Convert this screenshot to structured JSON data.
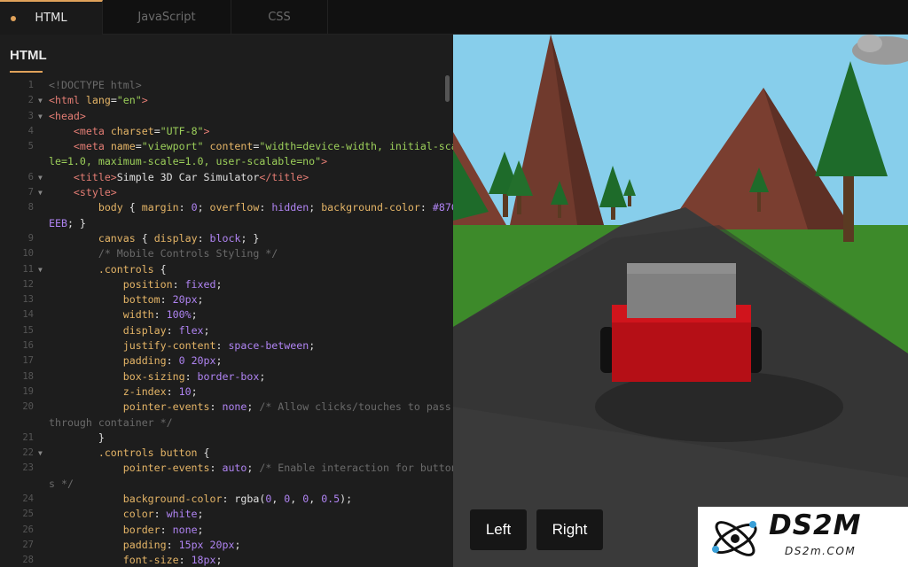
{
  "tabs": [
    {
      "label": "HTML",
      "active": true
    },
    {
      "label": "JavaScript",
      "active": false
    },
    {
      "label": "CSS",
      "active": false
    }
  ],
  "editor": {
    "title": "HTML",
    "lines": [
      {
        "n": "1",
        "fold": false,
        "html": "<span class='cm'>&lt;!DOCTYPE html&gt;</span>"
      },
      {
        "n": "2",
        "fold": true,
        "html": "<span class='tg'>&lt;html</span> <span class='at'>lang</span>=<span class='st'>\"en\"</span><span class='tg'>&gt;</span>"
      },
      {
        "n": "3",
        "fold": true,
        "html": "<span class='tg'>&lt;head&gt;</span>"
      },
      {
        "n": "4",
        "fold": false,
        "html": "    <span class='tg'>&lt;meta</span> <span class='at'>charset</span>=<span class='st'>\"UTF-8\"</span><span class='tg'>&gt;</span>"
      },
      {
        "n": "5",
        "fold": false,
        "html": "    <span class='tg'>&lt;meta</span> <span class='at'>name</span>=<span class='st'>\"viewport\"</span> <span class='at'>content</span>=<span class='st'>\"width=device-width, initial-sca</span>"
      },
      {
        "n": "",
        "fold": false,
        "html": "<span class='st'>le=1.0, maximum-scale=1.0, user-scalable=no\"</span><span class='tg'>&gt;</span>"
      },
      {
        "n": "6",
        "fold": true,
        "html": "    <span class='tg'>&lt;title&gt;</span>Simple 3D Car Simulator<span class='tg'>&lt;/title&gt;</span>"
      },
      {
        "n": "7",
        "fold": true,
        "html": "    <span class='tg'>&lt;style&gt;</span>"
      },
      {
        "n": "8",
        "fold": false,
        "html": "        <span class='sel'>body</span> { <span class='at'>margin</span>: <span class='kw'>0</span>; <span class='at'>overflow</span>: <span class='kw'>hidden</span>; <span class='at'>background-color</span>: <span class='kw'>#87C</span>"
      },
      {
        "n": "",
        "fold": false,
        "html": "<span class='kw'>EEB</span>; }"
      },
      {
        "n": "9",
        "fold": false,
        "html": "        <span class='sel'>canvas</span> { <span class='at'>display</span>: <span class='kw'>block</span>; }"
      },
      {
        "n": "10",
        "fold": false,
        "html": "        <span class='cm'>/* Mobile Controls Styling */</span>"
      },
      {
        "n": "11",
        "fold": true,
        "html": "        <span class='sel'>.controls</span> {"
      },
      {
        "n": "12",
        "fold": false,
        "html": "            <span class='at'>position</span>: <span class='kw'>fixed</span>;"
      },
      {
        "n": "13",
        "fold": false,
        "html": "            <span class='at'>bottom</span>: <span class='kw'>20px</span>;"
      },
      {
        "n": "14",
        "fold": false,
        "html": "            <span class='at'>width</span>: <span class='kw'>100%</span>;"
      },
      {
        "n": "15",
        "fold": false,
        "html": "            <span class='at'>display</span>: <span class='kw'>flex</span>;"
      },
      {
        "n": "16",
        "fold": false,
        "html": "            <span class='at'>justify-content</span>: <span class='kw'>space-between</span>;"
      },
      {
        "n": "17",
        "fold": false,
        "html": "            <span class='at'>padding</span>: <span class='kw'>0 20px</span>;"
      },
      {
        "n": "18",
        "fold": false,
        "html": "            <span class='at'>box-sizing</span>: <span class='kw'>border-box</span>;"
      },
      {
        "n": "19",
        "fold": false,
        "html": "            <span class='at'>z-index</span>: <span class='kw'>10</span>;"
      },
      {
        "n": "20",
        "fold": false,
        "html": "            <span class='at'>pointer-events</span>: <span class='kw'>none</span>; <span class='cm'>/* Allow clicks/touches to pass</span>"
      },
      {
        "n": "",
        "fold": false,
        "html": "<span class='cm'>through container */</span>"
      },
      {
        "n": "21",
        "fold": false,
        "html": "        }"
      },
      {
        "n": "22",
        "fold": true,
        "html": "        <span class='sel'>.controls button</span> {"
      },
      {
        "n": "23",
        "fold": false,
        "html": "            <span class='at'>pointer-events</span>: <span class='kw'>auto</span>; <span class='cm'>/* Enable interaction for button</span>"
      },
      {
        "n": "",
        "fold": false,
        "html": "<span class='cm'>s */</span>"
      },
      {
        "n": "24",
        "fold": false,
        "html": "            <span class='at'>background-color</span>: rgba(<span class='kw'>0</span>, <span class='kw'>0</span>, <span class='kw'>0</span>, <span class='kw'>0.5</span>);"
      },
      {
        "n": "25",
        "fold": false,
        "html": "            <span class='at'>color</span>: <span class='kw'>white</span>;"
      },
      {
        "n": "26",
        "fold": false,
        "html": "            <span class='at'>border</span>: <span class='kw'>none</span>;"
      },
      {
        "n": "27",
        "fold": false,
        "html": "            <span class='at'>padding</span>: <span class='kw'>15px 20px</span>;"
      },
      {
        "n": "28",
        "fold": false,
        "html": "            <span class='at'>font-size</span>: <span class='kw'>18px</span>;"
      }
    ]
  },
  "preview": {
    "left_button": "Left",
    "right_button": "Right",
    "sky_color": "#87CEEB"
  },
  "watermark": {
    "logo_text": "DS2M",
    "site_text": "DS2m.COM"
  },
  "colors": {
    "accent": "#e0a25a"
  }
}
